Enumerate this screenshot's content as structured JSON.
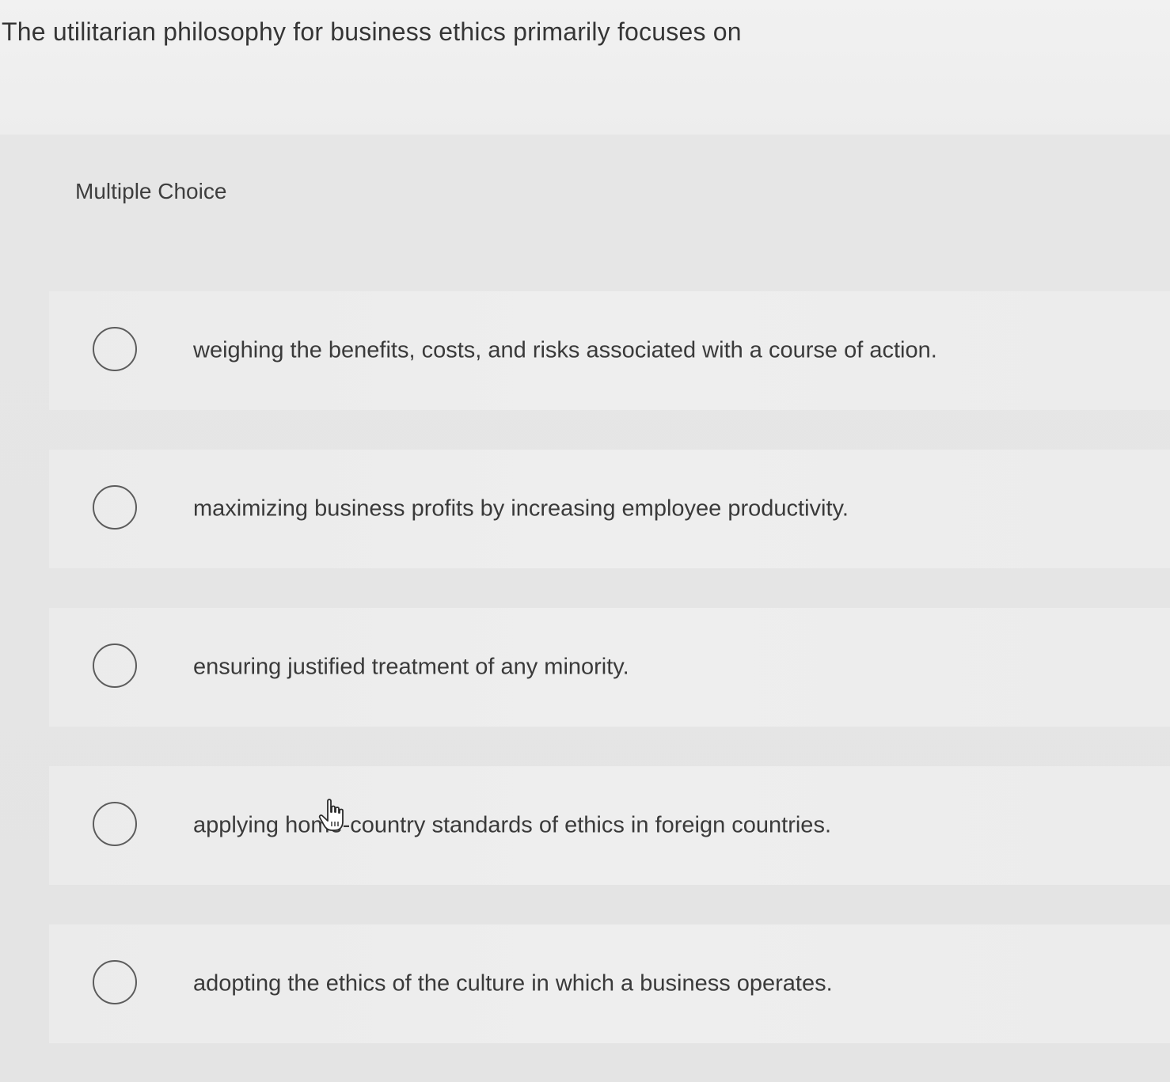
{
  "question": {
    "text": "The utilitarian philosophy for business ethics primarily focuses on"
  },
  "section": {
    "label": "Multiple Choice"
  },
  "options": [
    {
      "label": "weighing the benefits, costs, and risks associated with a course of action."
    },
    {
      "label": "maximizing business profits by increasing employee productivity."
    },
    {
      "label": "ensuring justified treatment of any minority."
    },
    {
      "label": "applying home-country standards of ethics in foreign countries."
    },
    {
      "label": "adopting the ethics of the culture in which a business operates."
    }
  ],
  "icons": {
    "cursor": "hand-pointer-icon",
    "radio": "radio-unselected-icon"
  },
  "colors": {
    "radio_border": "#5c5c5c",
    "text": "#3a3a3a",
    "background": "#ececec"
  }
}
